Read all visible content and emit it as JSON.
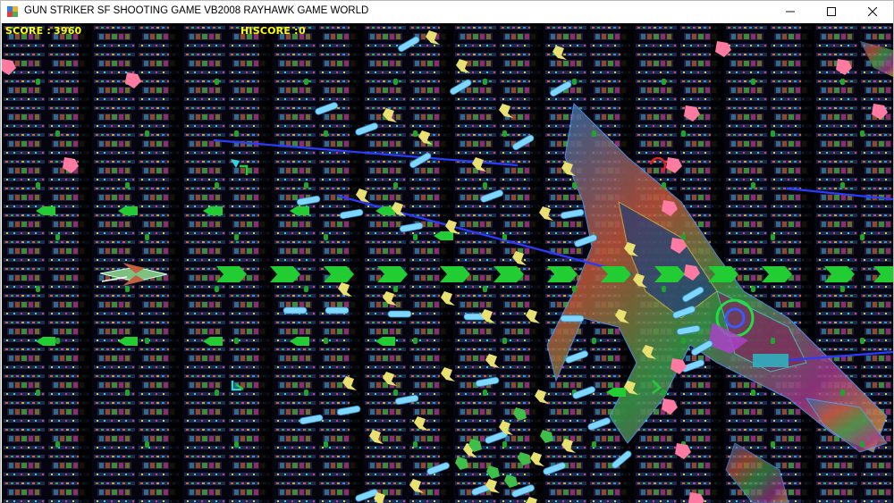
{
  "window": {
    "title": "GUN STRIKER SF SHOOTING GAME VB2008 RAYHAWK GAME WORLD",
    "icon": "app-icon",
    "controls": {
      "minimize": "minimize-icon",
      "maximize": "maximize-icon",
      "close": "close-icon"
    }
  },
  "hud": {
    "score_label": "SCORE :",
    "score_value": "3960",
    "hiscore_label": "HISCORE :",
    "hiscore_value": "0"
  },
  "colors": {
    "hud_text": "#ffff00",
    "background": "#000000",
    "laser": "#2a3bff",
    "enemy_bullet": "#7fd6ff",
    "green_shot": "#22cc33",
    "debris": "#e8e070",
    "pink_debris": "#ff7aa0"
  }
}
